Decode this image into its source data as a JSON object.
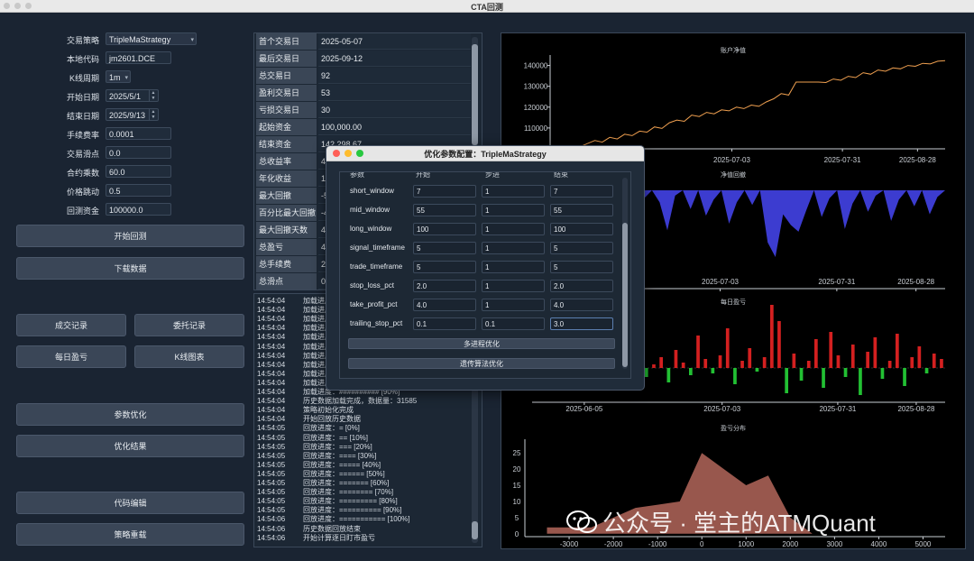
{
  "window": {
    "title": "CTA回测"
  },
  "form": {
    "rows": [
      {
        "label": "交易策略",
        "value": "TripleMaStrategy",
        "kind": "combo"
      },
      {
        "label": "本地代码",
        "value": "jm2601.DCE",
        "kind": "text"
      },
      {
        "label": "K线周期",
        "value": "1m",
        "kind": "combo"
      },
      {
        "label": "开始日期",
        "value": "2025/5/1",
        "kind": "date"
      },
      {
        "label": "结束日期",
        "value": "2025/9/13",
        "kind": "date"
      },
      {
        "label": "手续费率",
        "value": "0.0001",
        "kind": "text"
      },
      {
        "label": "交易滑点",
        "value": "0.0",
        "kind": "text"
      },
      {
        "label": "合约乘数",
        "value": "60.0",
        "kind": "text"
      },
      {
        "label": "价格跳动",
        "value": "0.5",
        "kind": "text"
      },
      {
        "label": "回测资金",
        "value": "100000.0",
        "kind": "text"
      }
    ]
  },
  "buttons": {
    "start_backtest": "开始回测",
    "download_data": "下载数据",
    "trade_records": "成交记录",
    "order_records": "委托记录",
    "daily_pnl": "每日盈亏",
    "kline_chart": "K线图表",
    "param_optimize": "参数优化",
    "optimize_result": "优化结果",
    "code_edit": "代码编辑",
    "strategy_reload": "策略重载"
  },
  "stats": [
    {
      "key": "首个交易日",
      "value": "2025-05-07"
    },
    {
      "key": "最后交易日",
      "value": "2025-09-12"
    },
    {
      "key": "总交易日",
      "value": "92"
    },
    {
      "key": "盈利交易日",
      "value": "53"
    },
    {
      "key": "亏损交易日",
      "value": "30"
    },
    {
      "key": "起始资金",
      "value": "100,000.00"
    },
    {
      "key": "结束资金",
      "value": "142,298.67"
    },
    {
      "key": "总收益率",
      "value": "42"
    },
    {
      "key": "年化收益",
      "value": "110"
    },
    {
      "key": "最大回撤",
      "value": "-5,"
    },
    {
      "key": "百分比最大回撤",
      "value": "-4."
    },
    {
      "key": "最大回撤天数",
      "value": "4"
    },
    {
      "key": "总盈亏",
      "value": "42"
    },
    {
      "key": "总手续费",
      "value": "21"
    },
    {
      "key": "总滑点",
      "value": "0.0"
    }
  ],
  "log": [
    {
      "t": "14:54:04",
      "m": "加载进度"
    },
    {
      "t": "14:54:04",
      "m": "加载进度"
    },
    {
      "t": "14:54:04",
      "m": "加载进度"
    },
    {
      "t": "14:54:04",
      "m": "加载进度"
    },
    {
      "t": "14:54:04",
      "m": "加载进度"
    },
    {
      "t": "14:54:04",
      "m": "加载进度"
    },
    {
      "t": "14:54:04",
      "m": "加载进度"
    },
    {
      "t": "14:54:04",
      "m": "加载进度"
    },
    {
      "t": "14:54:04",
      "m": "加载进度"
    },
    {
      "t": "14:54:04",
      "m": "加载进度"
    },
    {
      "t": "14:54:04",
      "m": "加载进度：########## [90%]"
    },
    {
      "t": "14:54:04",
      "m": "历史数据加载完成，数据量：31585"
    },
    {
      "t": "14:54:04",
      "m": "策略初始化完成"
    },
    {
      "t": "14:54:04",
      "m": "开始回放历史数据"
    },
    {
      "t": "14:54:05",
      "m": "回放进度：= [0%]"
    },
    {
      "t": "14:54:05",
      "m": "回放进度：== [10%]"
    },
    {
      "t": "14:54:05",
      "m": "回放进度：=== [20%]"
    },
    {
      "t": "14:54:05",
      "m": "回放进度：==== [30%]"
    },
    {
      "t": "14:54:05",
      "m": "回放进度：===== [40%]"
    },
    {
      "t": "14:54:05",
      "m": "回放进度：====== [50%]"
    },
    {
      "t": "14:54:05",
      "m": "回放进度：======= [60%]"
    },
    {
      "t": "14:54:05",
      "m": "回放进度：======== [70%]"
    },
    {
      "t": "14:54:05",
      "m": "回放进度：========= [80%]"
    },
    {
      "t": "14:54:05",
      "m": "回放进度：========== [90%]"
    },
    {
      "t": "14:54:06",
      "m": "回放进度：=========== [100%]"
    },
    {
      "t": "14:54:06",
      "m": "历史数据回放结束"
    },
    {
      "t": "14:54:06",
      "m": "开始计算逐日盯市盈亏"
    }
  ],
  "chart_data": [
    {
      "type": "line",
      "title": "账户净值",
      "color": "#f0a050",
      "ylim": [
        100000,
        145000
      ],
      "y_ticks": [
        "100000",
        "110000",
        "120000",
        "130000",
        "140000"
      ],
      "x_tick_labels": [
        "2025-06-05",
        "2025-07-03",
        "2025-07-31",
        "2025-08-28"
      ],
      "values": [
        100000,
        100400,
        100100,
        101300,
        101000,
        102500,
        104000,
        103200,
        105500,
        104700,
        107000,
        106300,
        108500,
        108000,
        110500,
        109800,
        112500,
        113800,
        113200,
        116200,
        115500,
        117500,
        116800,
        118700,
        118200,
        120000,
        119300,
        121000,
        120400,
        122500,
        124000,
        126500,
        125800,
        132000,
        132000,
        132000,
        132000,
        131800,
        133500,
        132900,
        134800,
        134200,
        136500,
        135800,
        137800,
        137200,
        138800,
        138400,
        140000,
        139600,
        141000,
        140700,
        142000,
        142300
      ]
    },
    {
      "type": "area",
      "title": "净值回撤",
      "color": "#3c3cd0",
      "x_tick_labels": [
        "2025-06-05",
        "2025-07-03",
        "2025-07-31",
        "2025-08-28"
      ],
      "values": [
        0,
        -400,
        0,
        -1200,
        -600,
        0,
        -1800,
        -300,
        0,
        -2600,
        -800,
        0,
        -1500,
        0,
        -2200,
        -600,
        0,
        -900,
        -3000,
        -400,
        0,
        -1400,
        0,
        -1900,
        -700,
        0,
        -2500,
        -900,
        0,
        -1100,
        0,
        -3900,
        -5000,
        -1800,
        -2600,
        -3100,
        -1500,
        0,
        -2000,
        -600,
        0,
        -2900,
        -1000,
        0,
        -1600,
        -400,
        0,
        -2300,
        -700,
        0,
        -1200,
        0,
        -1800,
        -500,
        0
      ]
    },
    {
      "type": "bar",
      "title": "每日盈亏",
      "x_tick_labels": [
        "2025-06-05",
        "2025-07-03",
        "2025-07-31",
        "2025-08-28"
      ],
      "values": [
        300,
        -200,
        500,
        800,
        -400,
        200,
        900,
        -300,
        400,
        1200,
        -600,
        300,
        700,
        -200,
        1500,
        -500,
        200,
        600,
        -800,
        1000,
        300,
        -400,
        1800,
        500,
        -300,
        700,
        2200,
        -900,
        400,
        1100,
        -200,
        600,
        3500,
        2600,
        -1400,
        800,
        -700,
        400,
        1600,
        -1100,
        2000,
        700,
        -500,
        1300,
        -1500,
        900,
        1700,
        -600,
        400,
        1900,
        -1000,
        600,
        1200,
        -300,
        800,
        500
      ]
    },
    {
      "type": "area",
      "title": "盈亏分布",
      "color": "#a86055",
      "x_ticks": [
        -3000,
        -2000,
        -1000,
        0,
        1000,
        2000,
        3000,
        4000,
        5000
      ],
      "y_ticks": [
        0,
        5,
        10,
        15,
        20,
        25
      ],
      "x": [
        -3500,
        -2500,
        -2000,
        -1500,
        -1000,
        -500,
        0,
        500,
        1000,
        1500,
        2000,
        2500,
        3000
      ],
      "values": [
        2,
        2,
        5,
        8,
        9,
        10,
        25,
        20,
        15,
        18,
        5,
        0,
        0
      ]
    }
  ],
  "dialog": {
    "title": "优化参数配置：TripleMaStrategy",
    "headers": [
      "参数",
      "开始",
      "步进",
      "结束"
    ],
    "params": [
      {
        "name": "short_window",
        "start": "7",
        "step": "1",
        "end": "7"
      },
      {
        "name": "mid_window",
        "start": "55",
        "step": "1",
        "end": "55"
      },
      {
        "name": "long_window",
        "start": "100",
        "step": "1",
        "end": "100"
      },
      {
        "name": "signal_timeframe",
        "start": "5",
        "step": "1",
        "end": "5"
      },
      {
        "name": "trade_timeframe",
        "start": "5",
        "step": "1",
        "end": "5"
      },
      {
        "name": "stop_loss_pct",
        "start": "2.0",
        "step": "1",
        "end": "2.0"
      },
      {
        "name": "take_profit_pct",
        "start": "4.0",
        "step": "1",
        "end": "4.0"
      },
      {
        "name": "trailing_stop_pct",
        "start": "0.1",
        "step": "0.1",
        "end": "3.0"
      }
    ],
    "multiprocess_btn": "多进程优化",
    "genetic_btn": "遗传算法优化"
  },
  "watermark": "公众号 · 堂主的ATMQuant",
  "colors": {
    "accent": "#3a4657",
    "bg": "#1a2432",
    "profit": "#d42020",
    "loss": "#22c033"
  }
}
